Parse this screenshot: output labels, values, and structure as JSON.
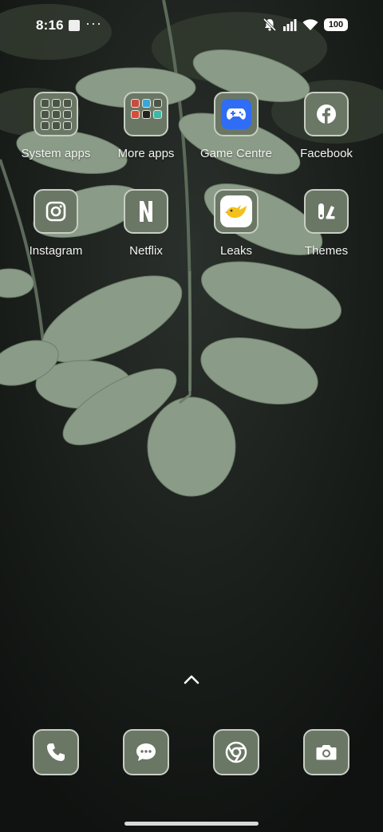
{
  "status_bar": {
    "time": "8:16",
    "more_indicator": "···",
    "battery": "100",
    "icons": [
      "notification-square-icon",
      "silent-icon",
      "signal-icon",
      "wifi-icon",
      "battery-icon"
    ]
  },
  "apps": [
    {
      "label": "System apps",
      "icon": "folder-icon"
    },
    {
      "label": "More apps",
      "icon": "folder-icon"
    },
    {
      "label": "Game Centre",
      "icon": "gamepad-icon"
    },
    {
      "label": "Facebook",
      "icon": "facebook-icon"
    },
    {
      "label": "Instagram",
      "icon": "instagram-icon"
    },
    {
      "label": "Netflix",
      "icon": "netflix-icon"
    },
    {
      "label": "Leaks",
      "icon": "bird-icon"
    },
    {
      "label": "Themes",
      "icon": "themes-icon"
    }
  ],
  "dock": [
    "phone-icon",
    "messages-icon",
    "chrome-icon",
    "camera-icon"
  ],
  "colors": {
    "tile": "#6b7765",
    "tile_border": "#c8cec4",
    "game_blue": "#2f6df6",
    "leaks_yellow": "#f2c21b"
  }
}
